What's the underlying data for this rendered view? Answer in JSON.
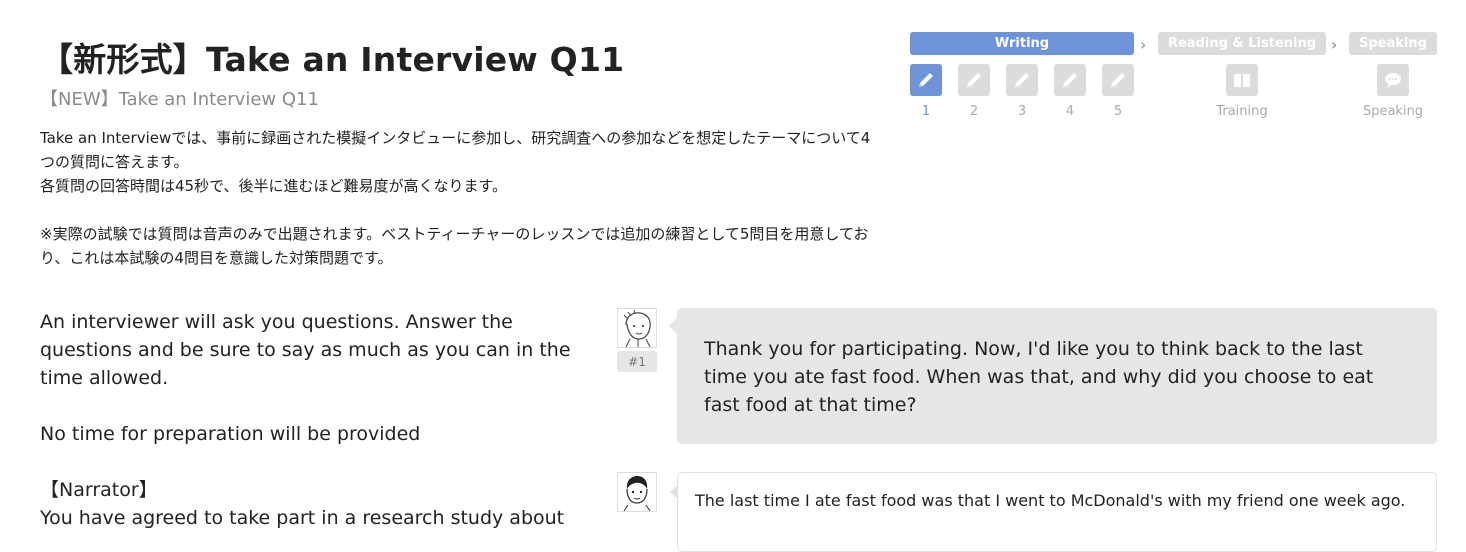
{
  "header": {
    "title": "【新形式】Take an Interview Q11",
    "subtitle": "【NEW】Take an Interview Q11"
  },
  "intro": {
    "paragraph1": "Take an Interviewでは、事前に録画された模擬インタビューに参加し、研究調査への参加などを想定したテーマについて4つの質問に答えます。",
    "paragraph2": "各質問の回答時間は45秒で、後半に進むほど難易度が高くなります。",
    "note": "※実際の試験では質問は音声のみで出題されます。ベストティーチャーのレッスンでは追加の練習として5問目を用意しており、これは本試験の4問目を意識した対策問題です。"
  },
  "stepper": {
    "phases": [
      {
        "label": "Writing",
        "state": "active"
      },
      {
        "label": "Reading & Listening",
        "state": "inactive"
      },
      {
        "label": "Speaking",
        "state": "inactive"
      }
    ],
    "steps": [
      {
        "label": "1",
        "icon": "pencil-icon",
        "state": "active"
      },
      {
        "label": "2",
        "icon": "pencil-icon",
        "state": "inactive"
      },
      {
        "label": "3",
        "icon": "pencil-icon",
        "state": "inactive"
      },
      {
        "label": "4",
        "icon": "pencil-icon",
        "state": "inactive"
      },
      {
        "label": "5",
        "icon": "pencil-icon",
        "state": "inactive"
      },
      {
        "label": "Training",
        "icon": "book-icon",
        "state": "inactive"
      },
      {
        "label": "Speaking",
        "icon": "speech-bubble-icon",
        "state": "inactive"
      }
    ],
    "colors": {
      "active": "#6f93d8",
      "inactive": "#dcdcdc"
    }
  },
  "instructions": {
    "line1": "An interviewer will ask you questions. Answer the questions and be sure to say as much as you can in the time allowed.",
    "line2": "No time for preparation will be provided",
    "narrator_label": "【Narrator】",
    "narrator_text": "You have agreed to take part in a research study about"
  },
  "chat": {
    "interviewer_badge": "#1",
    "question": "Thank you for participating. Now, I'd like you to think back to the last time you ate fast food. When was that, and why did you choose to eat fast food at that time?",
    "answer": "The last time I ate fast food was that I went to McDonald's with my friend one week ago."
  }
}
